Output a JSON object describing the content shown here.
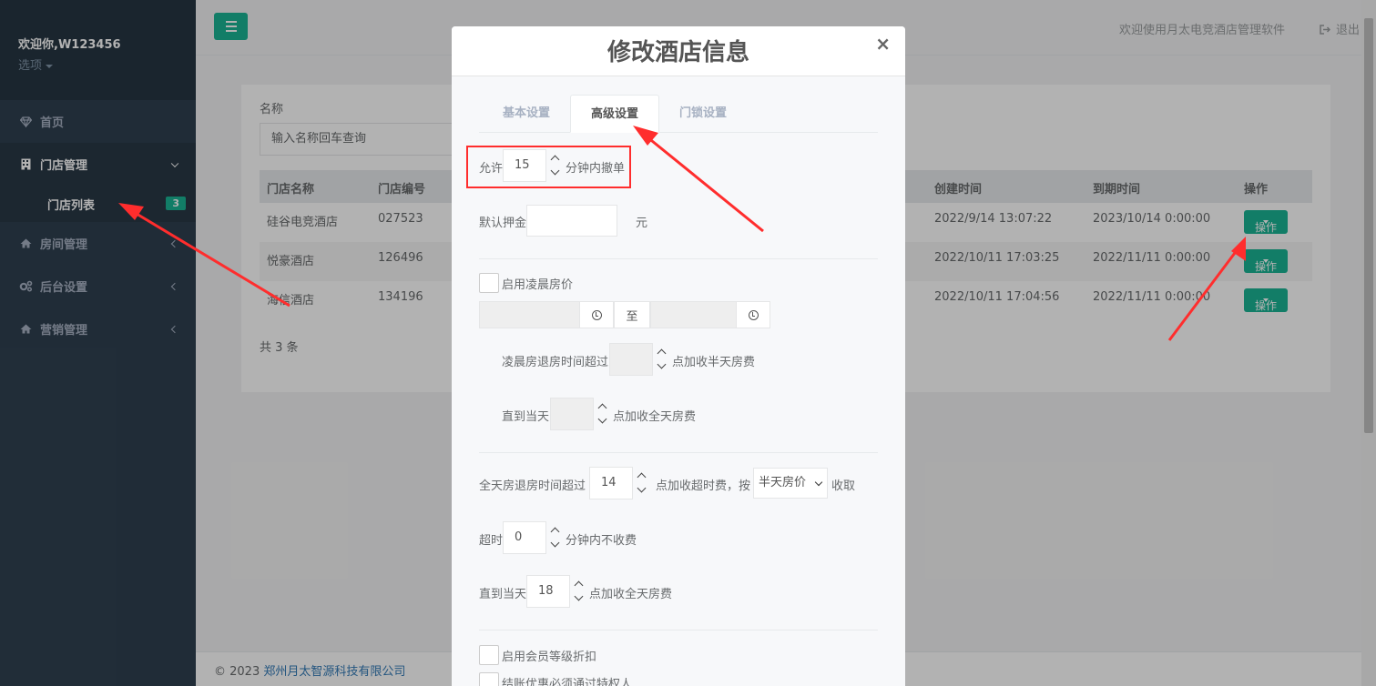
{
  "sidebar": {
    "user_name": "欢迎你,W123456",
    "options_label": "选项",
    "items": [
      {
        "label": "首页",
        "icon": "diamond-icon"
      },
      {
        "label": "门店管理",
        "icon": "building-icon"
      },
      {
        "label": "门店列表",
        "badge": "3"
      },
      {
        "label": "房间管理",
        "icon": "home-icon"
      },
      {
        "label": "后台设置",
        "icon": "cogs-icon"
      },
      {
        "label": "营销管理",
        "icon": "home-icon"
      }
    ]
  },
  "topbar": {
    "welcome": "欢迎使用月太电竞酒店管理软件",
    "logout": "退出"
  },
  "content": {
    "name_label": "名称",
    "search_placeholder": "输入名称回车查询",
    "columns": [
      "门店名称",
      "门店编号",
      "创建时间",
      "到期时间",
      "操作"
    ],
    "rows": [
      {
        "name": "硅谷电竞酒店",
        "code": "027523",
        "created": "2022/9/14 13:07:22",
        "expires": "2023/10/14 0:00:00",
        "action": "操作"
      },
      {
        "name": "悦豪酒店",
        "code": "126496",
        "created": "2022/10/11 17:03:25",
        "expires": "2022/11/11 0:00:00",
        "action": "操作"
      },
      {
        "name": "海信酒店",
        "code": "134196",
        "created": "2022/10/11 17:04:56",
        "expires": "2022/11/11 0:00:00",
        "action": "操作"
      }
    ],
    "total": "共 3 条"
  },
  "footer": {
    "copyright": "© 2023",
    "company": "郑州月太智源科技有限公司"
  },
  "modal": {
    "title": "修改酒店信息",
    "close": "×",
    "tabs": [
      "基本设置",
      "高级设置",
      "门锁设置"
    ],
    "cancel_prefix": "允许",
    "cancel_minutes": "15",
    "cancel_suffix": "分钟内撤单",
    "deposit_label": "默认押金",
    "deposit_unit": "元",
    "dawn_label": "启用凌晨房价",
    "to_label": "至",
    "dawn_half_prefix": "凌晨房退房时间超过",
    "dawn_half_suffix": "点加收半天房费",
    "dawn_full_prefix": "直到当天",
    "dawn_full_suffix": "点加收全天房费",
    "fullday_prefix": "全天房退房时间超过",
    "fullday_hour": "14",
    "fullday_mid": "点加收超时费，按",
    "fullday_select": "半天房价",
    "fullday_suffix": "收取",
    "overtime_prefix": "超时",
    "overtime_minutes": "0",
    "overtime_suffix": "分钟内不收费",
    "until_prefix": "直到当天",
    "until_hour": "18",
    "until_suffix": "点加收全天房费",
    "member_discount": "启用会员等级折扣",
    "privilege_label": "结账优惠必须通过特权人"
  }
}
